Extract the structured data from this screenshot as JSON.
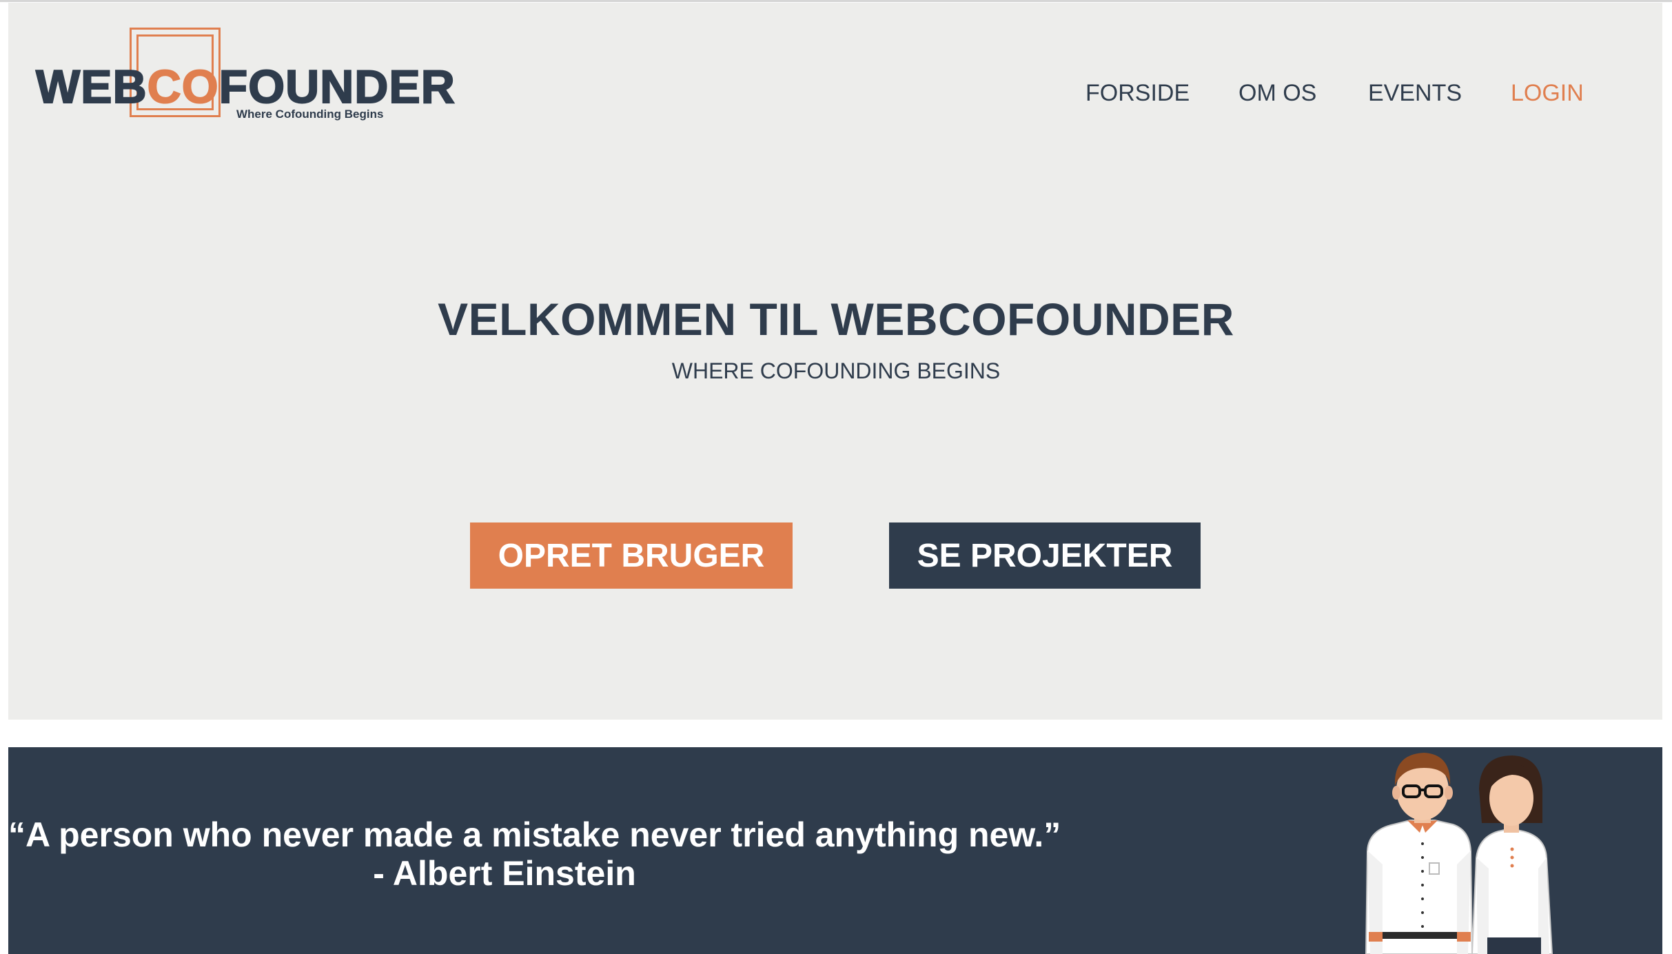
{
  "logo": {
    "part_before": "WEB",
    "part_accent": "CO",
    "part_after": "FOUNDER",
    "tagline": "Where Cofounding Begins"
  },
  "nav": {
    "items": [
      {
        "label": "FORSIDE",
        "active": false
      },
      {
        "label": "OM OS",
        "active": false
      },
      {
        "label": "EVENTS",
        "active": false
      },
      {
        "label": "LOGIN",
        "active": true
      }
    ]
  },
  "hero": {
    "title": "VELKOMMEN TIL WEBCOFOUNDER",
    "subtitle": "WHERE COFOUNDING BEGINS"
  },
  "buttons": {
    "primary_label": "OPRET BRUGER",
    "secondary_label": "SE PROJEKTER"
  },
  "quote": {
    "text": "“A person who never made a mistake never tried anything new.”",
    "author": "- Albert Einstein"
  },
  "colors": {
    "accent": "#e07f4f",
    "dark": "#2f3c4c",
    "hero_bg": "#ededeb"
  },
  "illustration": "man-and-woman-cofounders"
}
